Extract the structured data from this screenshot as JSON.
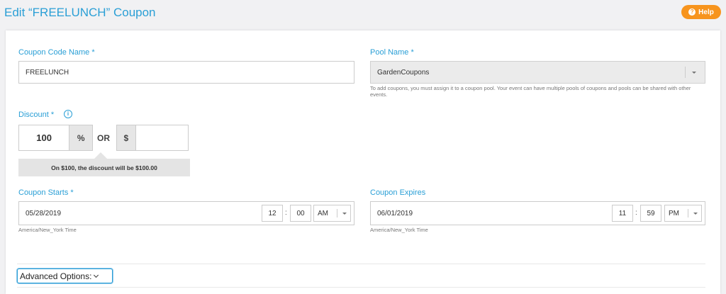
{
  "header": {
    "title": "Edit “FREELUNCH” Coupon",
    "help_label": "Help"
  },
  "form": {
    "coupon_code": {
      "label": "Coupon Code Name *",
      "value": "FREELUNCH"
    },
    "pool": {
      "label": "Pool Name *",
      "value": "GardenCoupons",
      "help": "To add coupons, you must assign it to a coupon pool. Your event can have multiple pools of coupons and pools can be shared with other events."
    },
    "discount": {
      "label": "Discount *",
      "percent_value": "100",
      "percent_symbol": "%",
      "or_label": "OR",
      "dollar_symbol": "$",
      "dollar_value": "",
      "note": "On $100, the discount will be $100.00"
    },
    "starts": {
      "label": "Coupon Starts *",
      "date": "05/28/2019",
      "hour": "12",
      "minute": "00",
      "ampm": "AM",
      "timezone": "America/New_York Time"
    },
    "expires": {
      "label": "Coupon Expires",
      "date": "06/01/2019",
      "hour": "11",
      "minute": "59",
      "ampm": "PM",
      "timezone": "America/New_York Time"
    },
    "advanced_label": "Advanced Options:"
  },
  "colors": {
    "accent": "#2a9fd6",
    "help_button": "#f7941d"
  }
}
